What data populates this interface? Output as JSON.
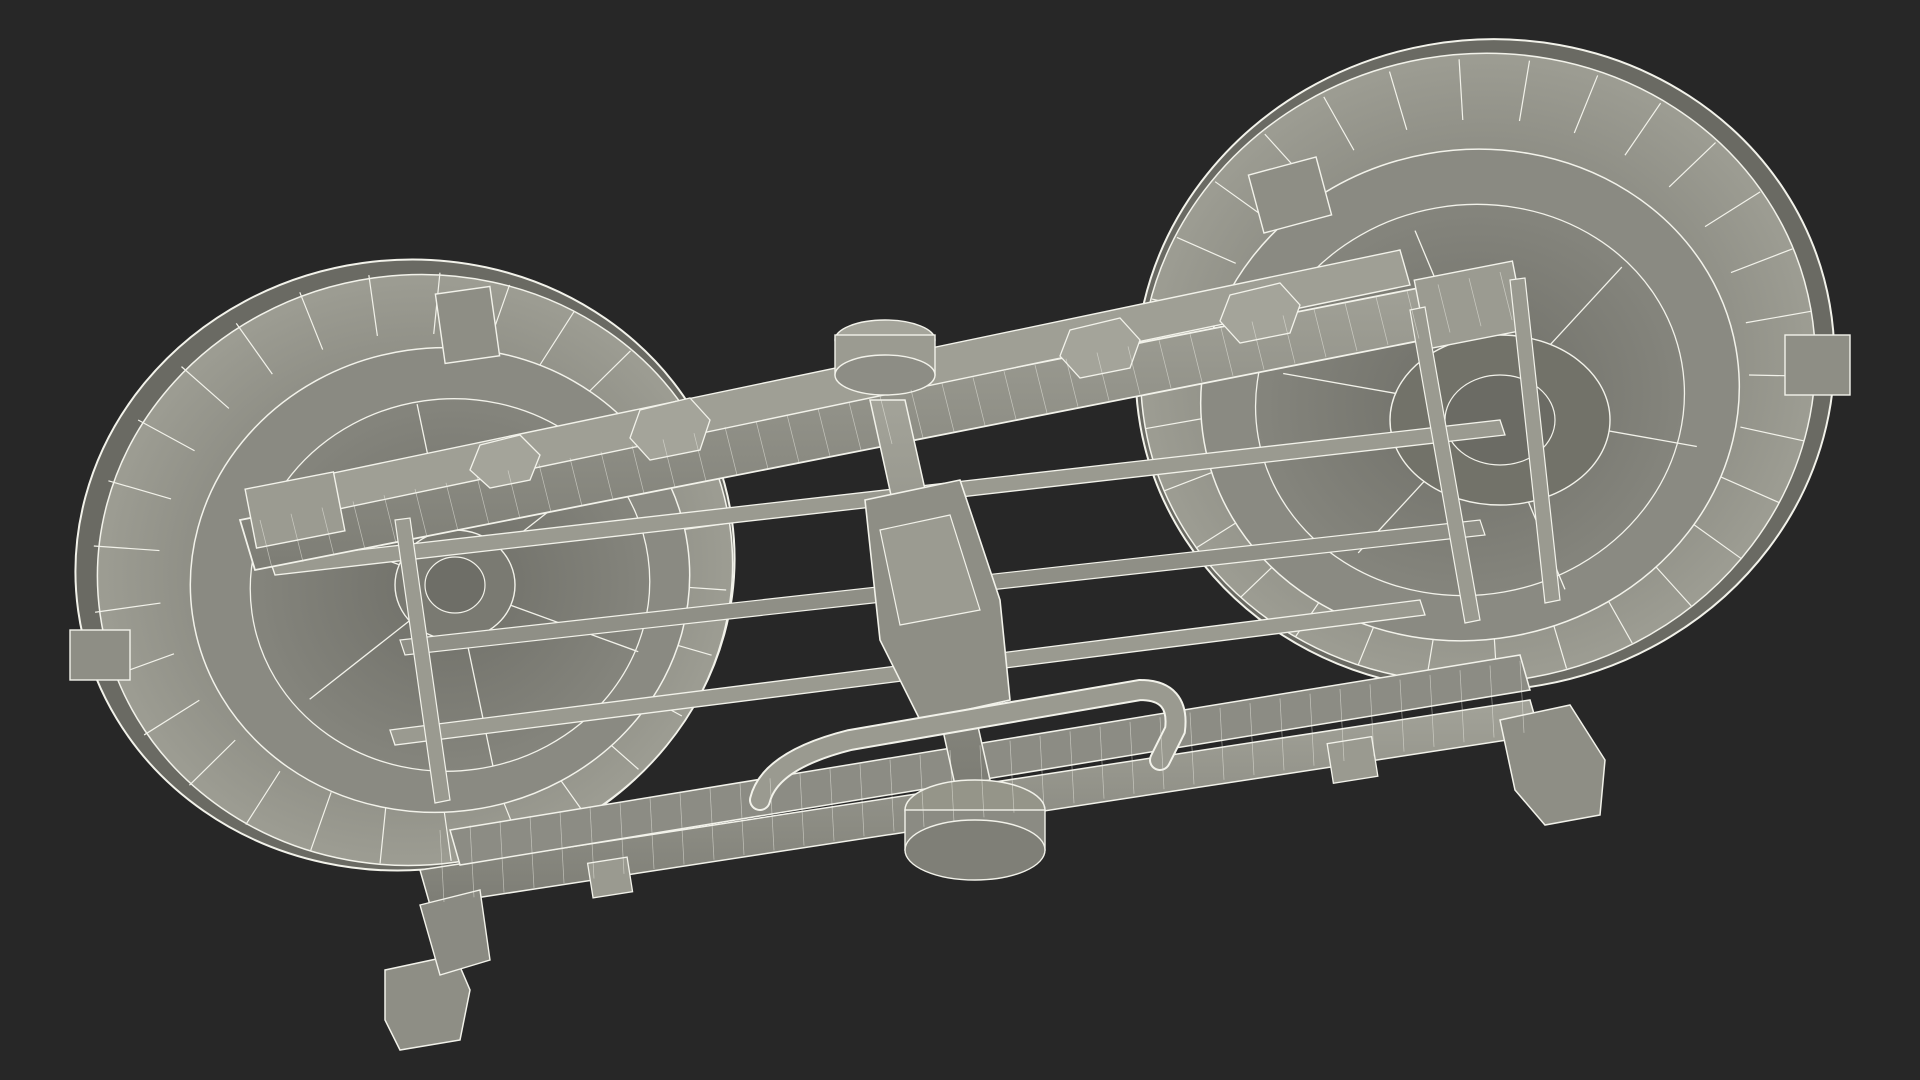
{
  "scene": {
    "subject": "",
    "colors": {
      "background": "#272727",
      "surface": "#8f8f86",
      "surface_dark": "#6a6a63",
      "surface_light": "#a7a79d",
      "shadow": "#55554f",
      "wire": "#f2f2ea"
    }
  }
}
